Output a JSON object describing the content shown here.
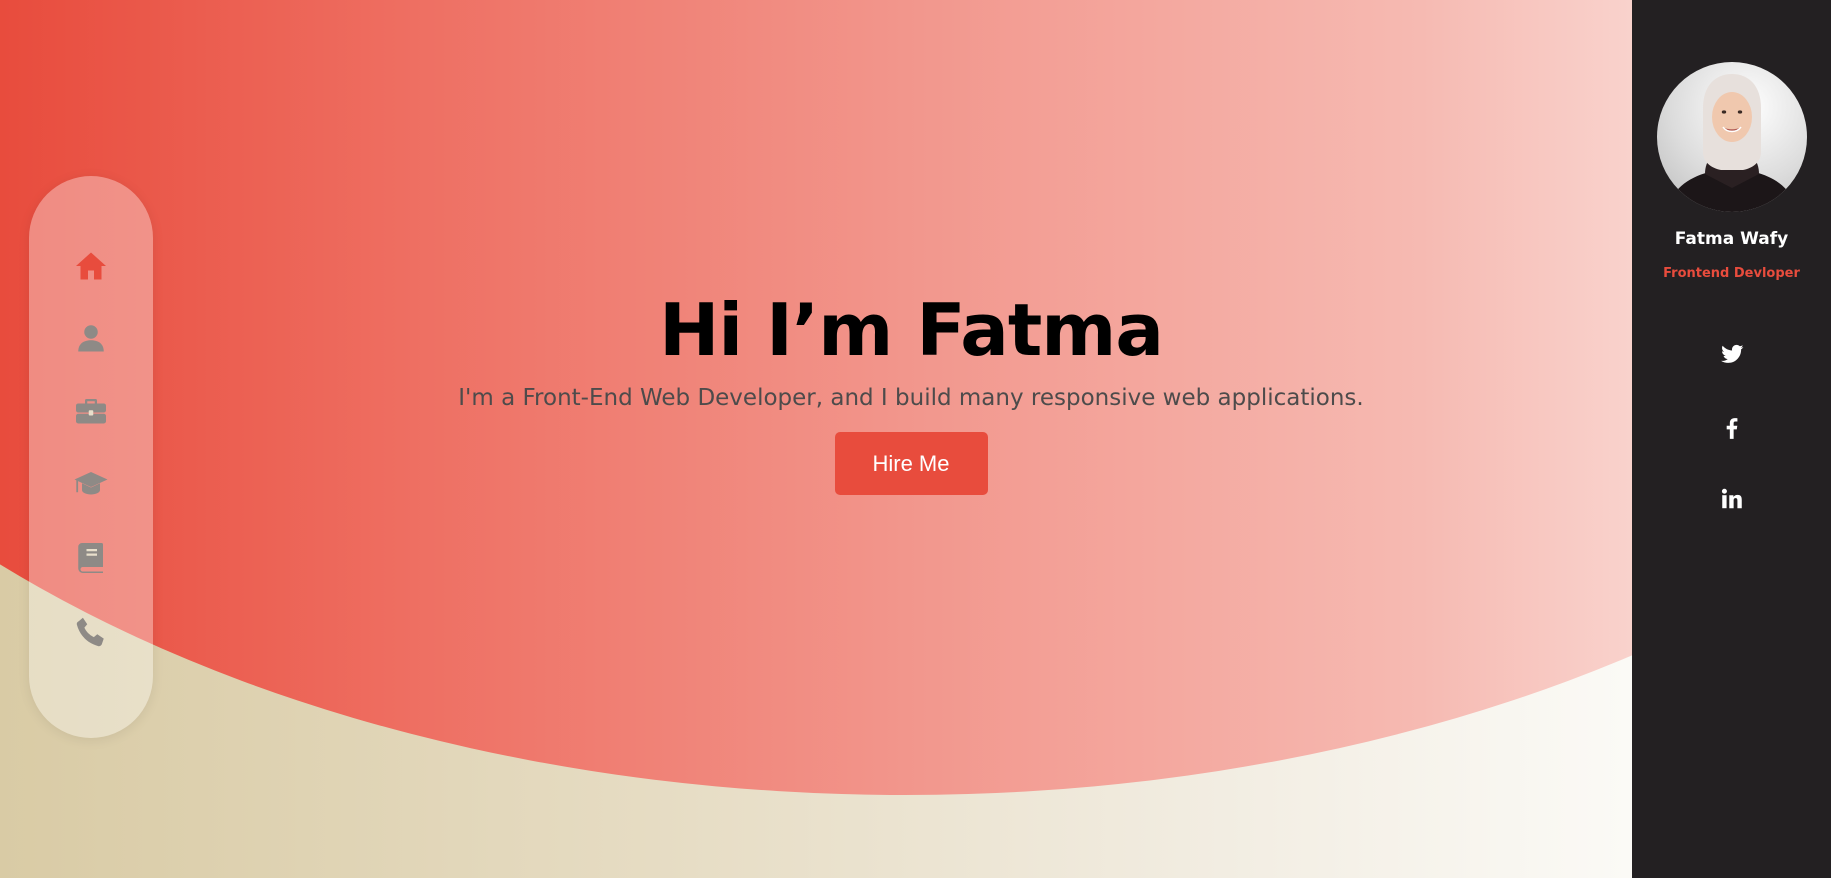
{
  "colors": {
    "accent": "#e84c3d",
    "sidebar_bg": "#232022",
    "nav_icon_inactive": "#8e8a86"
  },
  "nav": {
    "items": [
      {
        "icon": "home-icon",
        "label": "Home",
        "active": true
      },
      {
        "icon": "user-icon",
        "label": "About",
        "active": false
      },
      {
        "icon": "briefcase-icon",
        "label": "Portfolio",
        "active": false
      },
      {
        "icon": "graduation-cap-icon",
        "label": "Education",
        "active": false
      },
      {
        "icon": "book-icon",
        "label": "Blog",
        "active": false
      },
      {
        "icon": "phone-icon",
        "label": "Contact",
        "active": false
      }
    ]
  },
  "hero": {
    "title": "Hi I’m Fatma",
    "subtitle": "I'm a Front-End Web Developer, and I build many responsive web applications.",
    "cta_label": "Hire Me"
  },
  "profile": {
    "name": "Fatma Wafy",
    "role": "Frontend Devloper"
  },
  "social": {
    "items": [
      {
        "icon": "twitter-icon"
      },
      {
        "icon": "facebook-icon"
      },
      {
        "icon": "linkedin-icon"
      }
    ]
  }
}
